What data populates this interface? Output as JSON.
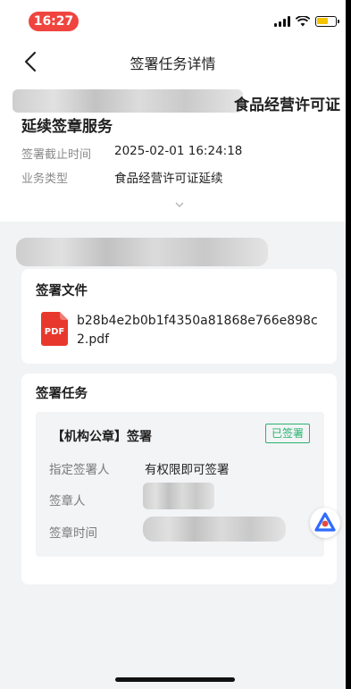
{
  "status_bar": {
    "time": "16:27",
    "time_pill_color": "#f0443e",
    "battery_color": "#f5c400"
  },
  "nav": {
    "title": "签署任务详情",
    "back_icon": "chevron-left-icon"
  },
  "task": {
    "title_tail": "食品经营许可证",
    "title_line2": "延续签章服务",
    "deadline_label": "签署截止时间",
    "deadline_value": "2025-02-01 16:24:18",
    "business_type_label": "业务类型",
    "business_type_value": "食品经营许可证延续",
    "expand_icon": "chevron-down-icon"
  },
  "files_card": {
    "title": "签署文件",
    "pdf_icon_text": "PDF",
    "pdf_icon_color": "#e8382d",
    "file_name": "b28b4e2b0b1f4350a81868e766e898c2.pdf"
  },
  "tasks_card": {
    "title": "签署任务",
    "seal_title": "【机构公章】签署",
    "status_badge": "已签署",
    "status_color": "#27b46e",
    "designated_signer_label": "指定签署人",
    "designated_signer_value": "有权限即可签署",
    "signer_label": "签章人",
    "sign_time_label": "签章时间"
  },
  "floating_button_icon": "assistant-icon"
}
